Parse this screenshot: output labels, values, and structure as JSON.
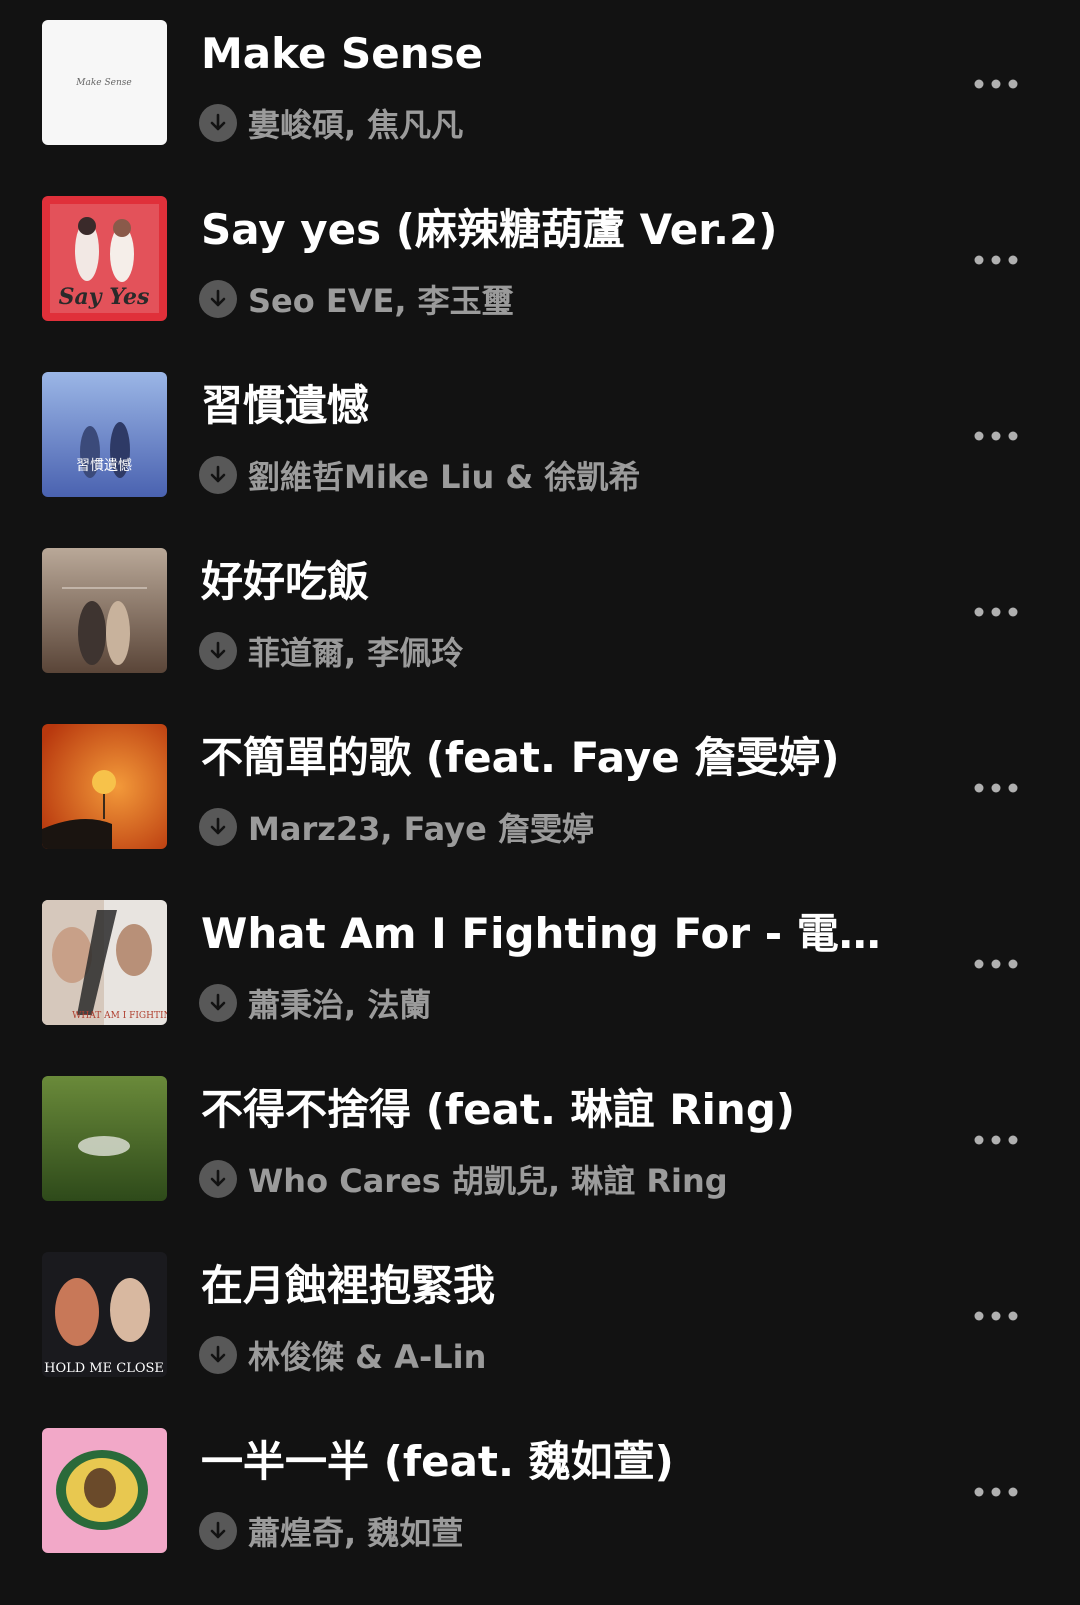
{
  "tracks": [
    {
      "title": "Make Sense",
      "artist": "婁峻碩, 焦凡凡",
      "cover_text": "Make Sense"
    },
    {
      "title": "Say yes (麻辣糖葫蘆 Ver.2)",
      "artist": "Seo EVE, 李玉璽",
      "cover_text": "Say Yes"
    },
    {
      "title": "習慣遺憾",
      "artist": "劉維哲Mike Liu & 徐凱希",
      "cover_text": "習慣遺憾"
    },
    {
      "title": "好好吃飯",
      "artist": "菲道爾, 李佩玲",
      "cover_text": ""
    },
    {
      "title": "不簡單的歌 (feat. Faye 詹雯婷)",
      "artist": "Marz23, Faye 詹雯婷",
      "cover_text": ""
    },
    {
      "title": "What Am I Fighting For - 電影《…",
      "artist": "蕭秉治, 法蘭",
      "cover_text": "WHAT AM I FIGHTING FOR"
    },
    {
      "title": "不得不捨得 (feat. 琳誼 Ring)",
      "artist": "Who Cares 胡凱兒, 琳誼 Ring",
      "cover_text": ""
    },
    {
      "title": "在月蝕裡抱緊我",
      "artist": "林俊傑 & A-Lin",
      "cover_text": "HOLD ME CLOSE"
    },
    {
      "title": "一半一半 (feat. 魏如萱)",
      "artist": "蕭煌奇, 魏如萱",
      "cover_text": ""
    }
  ],
  "icons": {
    "download": "download-arrow-icon",
    "more": "more-horizontal-icon"
  },
  "colors": {
    "background": "#121212",
    "title": "#ffffff",
    "artist": "#9b9b9b",
    "download_badge": "#585858"
  }
}
